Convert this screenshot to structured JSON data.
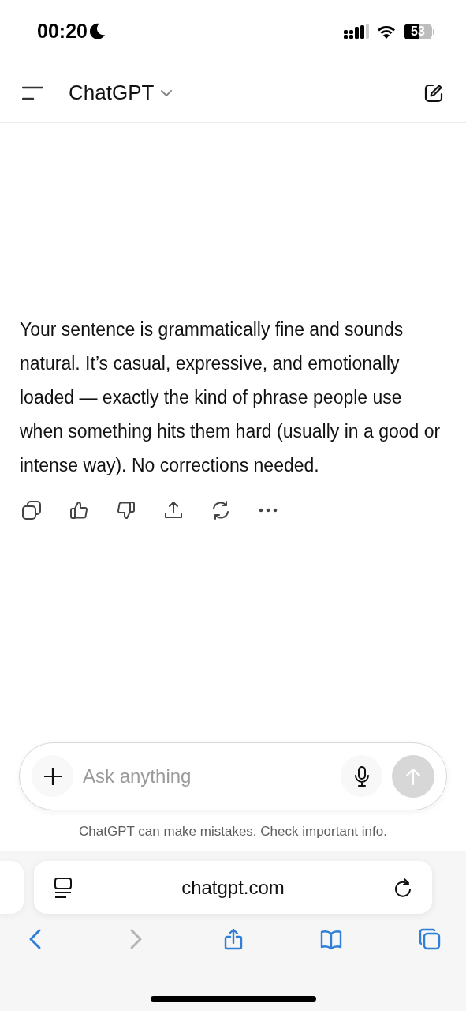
{
  "status_bar": {
    "time": "00:20",
    "battery": "53"
  },
  "header": {
    "title": "ChatGPT"
  },
  "message": {
    "text": "Your sentence is grammatically fine and sounds natural. It’s casual, expressive, and emotionally loaded — exactly the kind of phrase people use when something hits them hard (usually in a good or intense way). No corrections needed."
  },
  "composer": {
    "placeholder": "Ask anything",
    "send_disabled": true
  },
  "disclaimer": "ChatGPT can make mistakes. Check important info.",
  "browser": {
    "url": "chatgpt.com",
    "toolbar": [
      {
        "kind": "back",
        "disabled": false
      },
      {
        "kind": "forward",
        "disabled": true
      },
      {
        "kind": "share",
        "disabled": false
      },
      {
        "kind": "bookmarks",
        "disabled": false
      },
      {
        "kind": "tabs",
        "disabled": false
      }
    ]
  }
}
